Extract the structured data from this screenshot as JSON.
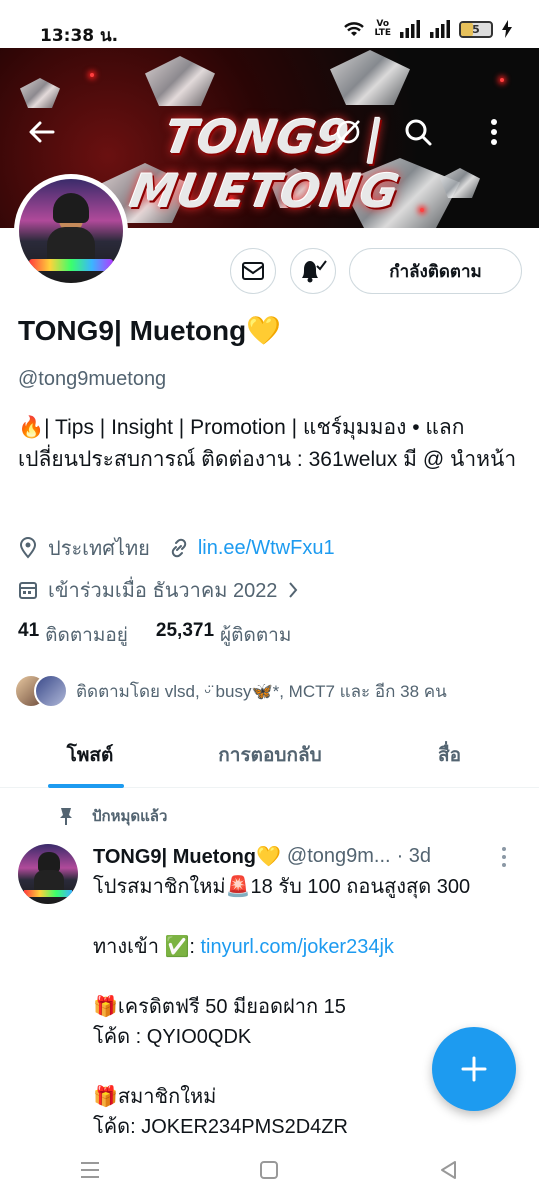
{
  "status": {
    "time": "13:38 น.",
    "volte_top": "Vo",
    "volte_bottom": "LTE",
    "battery": "5"
  },
  "banner": {
    "logo_text": "TONG9 | MUETONG"
  },
  "header": {
    "back_icon": "arrow-left-icon",
    "grok_icon": "grok-icon",
    "search_icon": "search-icon",
    "more_icon": "more-vertical-icon"
  },
  "actions": {
    "following_label": "กำลังติดตาม"
  },
  "profile": {
    "name": "TONG9| Muetong💛",
    "handle": "@tong9muetong",
    "bio": "🔥| Tips | Insight | Promotion |   แชร์มุมมอง • แลกเปลี่ยนประสบการณ์  ติดต่องาน : 361welux มี @ นำหน้า",
    "location": "ประเทศไทย",
    "link": "lin.ee/WtwFxu1",
    "joined": "เข้าร่วมเมื่อ ธันวาคม 2022",
    "following_count": "41",
    "following_label": "ติดตามอยู่",
    "followers_count": "25,371",
    "followers_label": "ผู้ติดตาม",
    "followed_by": "ติดตามโดย vlsd, ᵕ̈ busy🦋*, MCT7 และ อีก 38 คน"
  },
  "tabs": [
    {
      "label": "โพสต์"
    },
    {
      "label": "การตอบกลับ"
    },
    {
      "label": "สื่อ"
    }
  ],
  "post": {
    "pinned_label": "ปักหมุดแล้ว",
    "author": "TONG9| Muetong💛",
    "handle": "@tong9m...",
    "time": "· 3d",
    "lines": [
      "โปรสมาชิกใหม่🚨18 รับ 100 ถอนสูงสุด 300",
      "",
      "ทางเข้า ✅: ",
      "",
      "🎁เครดิตฟรี 50 มียอดฝาก 15",
      "โค้ด : QYIO0QDK",
      "",
      "🎁สมาชิกใหม่",
      "โค้ด: JOKER234PMS2D4ZR"
    ],
    "link": "tinyurl.com/joker234jk"
  },
  "colors": {
    "accent": "#1d9bf0",
    "secondary_text": "#536471"
  }
}
